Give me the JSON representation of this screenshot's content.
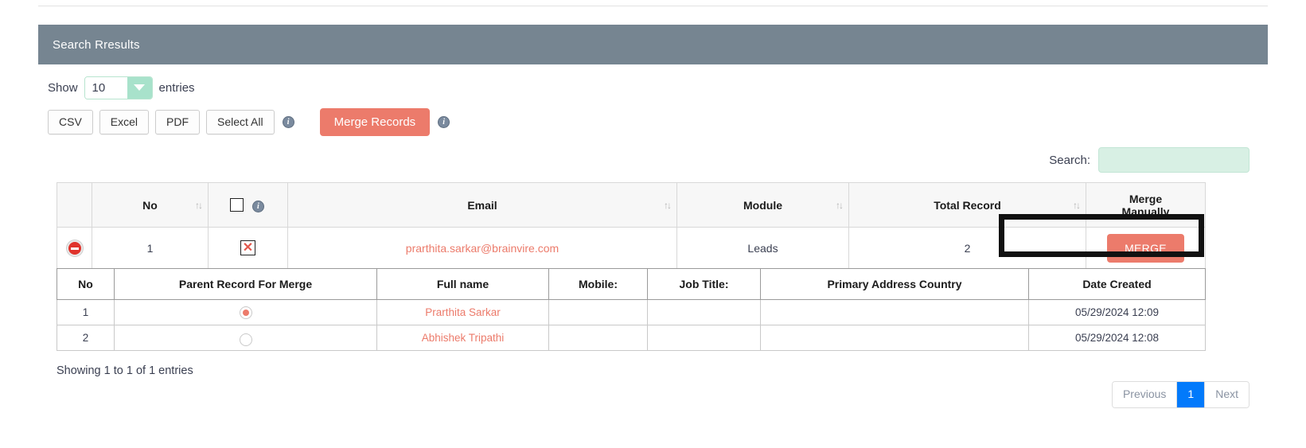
{
  "panel": {
    "title": "Search Rresults"
  },
  "length": {
    "show_label": "Show",
    "value": "10",
    "entries_label": "entries"
  },
  "toolbar": {
    "csv_label": "CSV",
    "excel_label": "Excel",
    "pdf_label": "PDF",
    "select_all_label": "Select All",
    "info_glyph": "i",
    "merge_records_label": "Merge Records"
  },
  "search": {
    "label": "Search:",
    "value": "",
    "placeholder": ""
  },
  "main_table": {
    "headers": {
      "action": "",
      "no": "No",
      "checkbox": "",
      "email": "Email",
      "module": "Module",
      "total_record": "Total Record",
      "merge_manually_line1": "Merge",
      "merge_manually_line2": "Manually"
    },
    "sort_glyph": "↑↓",
    "rows": [
      {
        "no": "1",
        "checkbox_mark": "✕",
        "email": "prarthita.sarkar@brainvire.com",
        "module": "Leads",
        "total_record": "2",
        "merge_label": "MERGE"
      }
    ]
  },
  "sub_table": {
    "headers": [
      "No",
      "Parent Record For Merge",
      "Full name",
      "Mobile:",
      "Job Title:",
      "Primary Address Country",
      "Date Created"
    ],
    "rows": [
      {
        "no": "1",
        "parent_selected": true,
        "full_name": "Prarthita Sarkar",
        "mobile": "",
        "job_title": "",
        "country": "",
        "date_created": "05/29/2024 12:09"
      },
      {
        "no": "2",
        "parent_selected": false,
        "full_name": "Abhishek Tripathi",
        "mobile": "",
        "job_title": "",
        "country": "",
        "date_created": "05/29/2024 12:08"
      }
    ]
  },
  "footer": {
    "showing": "Showing 1 to 1 of 1 entries",
    "previous_label": "Previous",
    "page_1_label": "1",
    "next_label": "Next"
  },
  "colors": {
    "header_bg": "#768591",
    "accent_coral": "#ec7b6b",
    "mint": "#a8e2cb",
    "search_bg": "#d8f0e4",
    "active_page": "#027afb"
  }
}
